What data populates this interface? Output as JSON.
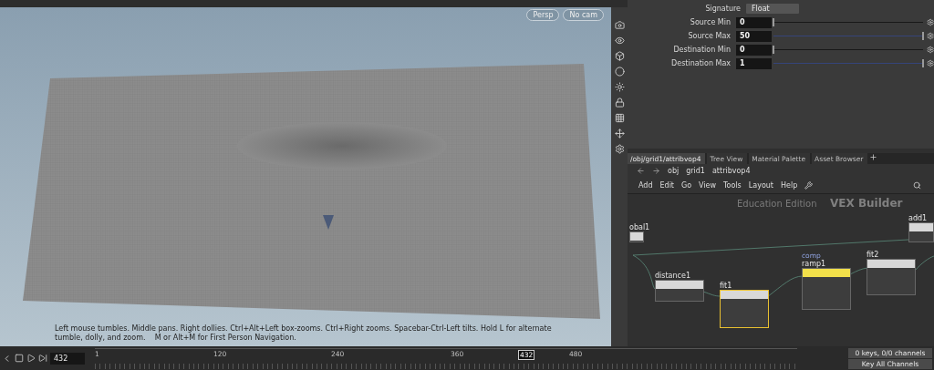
{
  "viewport": {
    "camera_buttons": [
      {
        "label": "Persp"
      },
      {
        "label": "No cam"
      }
    ],
    "status_message": "Left mouse tumbles. Middle pans. Right dollies. Ctrl+Alt+Left box-zooms. Ctrl+Right zooms. Spacebar-Ctrl-Left tilts. Hold L for alternate tumble, dolly, and zoom.    M or Alt+M for First Person Navigation."
  },
  "parameters": {
    "signature": {
      "label": "Signature",
      "value": "Float"
    },
    "rows": [
      {
        "label": "Source Min",
        "value": "0",
        "level": 0
      },
      {
        "label": "Source Max",
        "value": "50",
        "level": 1
      },
      {
        "label": "Destination Min",
        "value": "0",
        "level": 0
      },
      {
        "label": "Destination Max",
        "value": "1",
        "level": 1
      }
    ]
  },
  "network": {
    "tabs": [
      {
        "label": "/obj/grid1/attribvop4",
        "selected": true
      },
      {
        "label": "Tree View",
        "selected": false
      },
      {
        "label": "Material Palette",
        "selected": false
      },
      {
        "label": "Asset Browser",
        "selected": false
      }
    ],
    "path": [
      "obj",
      "grid1",
      "attribvop4"
    ],
    "menu": [
      "Add",
      "Edit",
      "Go",
      "View",
      "Tools",
      "Layout",
      "Help"
    ],
    "edition_label": "Education Edition",
    "context_label": "VEX Builder",
    "nodes": [
      {
        "name": "obal1",
        "selected": false,
        "color": "#d8d8d8"
      },
      {
        "name": "distance1",
        "selected": false,
        "color": "#d8d8d8"
      },
      {
        "name": "fit1",
        "selected": true,
        "color": "#d8d8d8"
      },
      {
        "name": "ramp1",
        "subtitle": "comp",
        "selected": false,
        "color": "#f2e04a"
      },
      {
        "name": "fit2",
        "selected": false,
        "color": "#d8d8d8"
      },
      {
        "name": "add1",
        "selected": false,
        "color": "#d8d8d8"
      }
    ]
  },
  "timeline": {
    "frame": "432",
    "ticks": [
      "1",
      "120",
      "240",
      "360",
      "480"
    ],
    "current": "432",
    "keys_info": "0 keys, 0/0 channels",
    "key_button": "Key All Channels"
  }
}
